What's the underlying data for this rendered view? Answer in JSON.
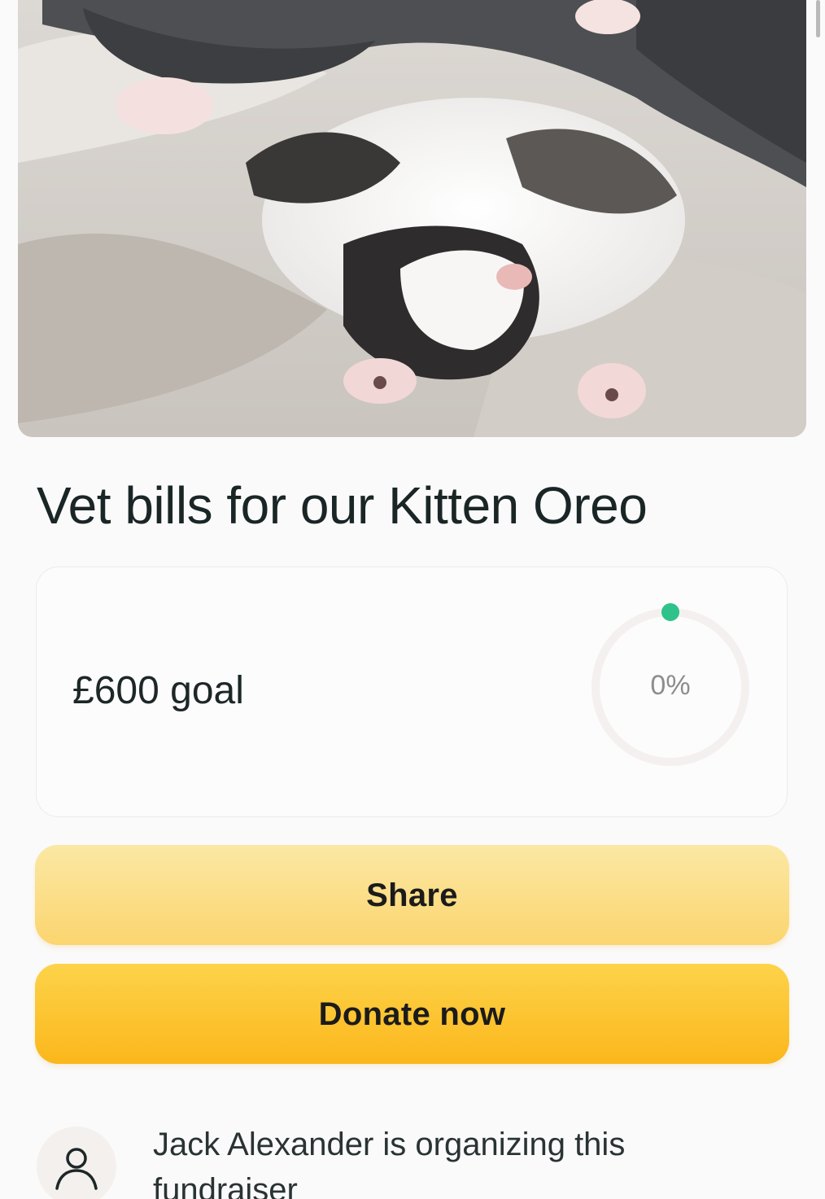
{
  "hero": {
    "image": "kitten-lying-on-blanket"
  },
  "campaign": {
    "title": "Vet bills for our Kitten Oreo"
  },
  "goal": {
    "text": "£600 goal",
    "progress_label": "0%",
    "progress_fraction": 0,
    "ring_color": "#2fc28a",
    "track_color": "#f3f0ef"
  },
  "actions": {
    "share_label": "Share",
    "donate_label": "Donate now"
  },
  "organizer": {
    "icon": "user-icon",
    "text": "Jack Alexander is organizing this fundraiser"
  }
}
